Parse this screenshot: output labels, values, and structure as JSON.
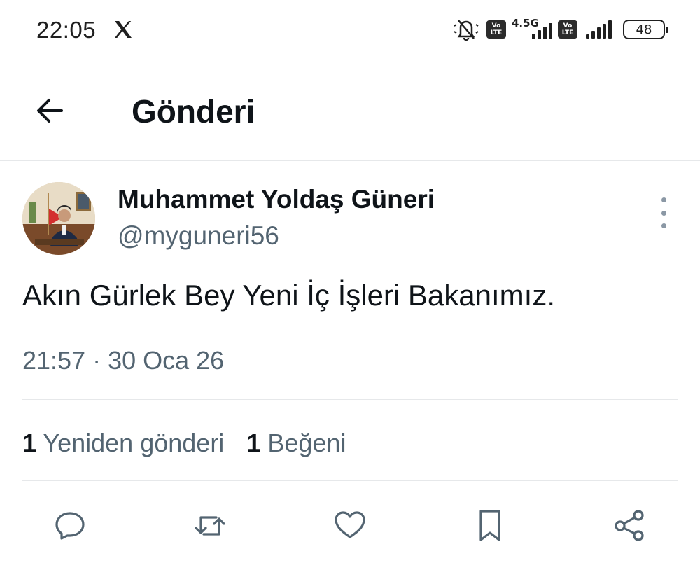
{
  "status_bar": {
    "time": "22:05",
    "app_icon": "x-logo-icon",
    "network_label": "4.5G",
    "volte_top": "Vo",
    "volte_bottom": "LTE",
    "battery": "48",
    "icons": [
      "silent-mode-icon",
      "volte-icon",
      "signal-icon",
      "volte-icon",
      "signal-icon",
      "battery-icon"
    ]
  },
  "header": {
    "back_icon": "arrow-left-icon",
    "title": "Gönderi"
  },
  "post": {
    "author_name": "Muhammet Yoldaş Güneri",
    "author_handle": "@myguneri56",
    "text": "Akın Gürlek Bey Yeni İç İşleri Bakanımız.",
    "time": "21:57",
    "separator": " · ",
    "date": "30 Oca 26",
    "reposts_count": "1",
    "reposts_label": "Yeniden gönderi",
    "likes_count": "1",
    "likes_label": "Beğeni"
  },
  "actions": [
    "reply-icon",
    "repost-icon",
    "like-icon",
    "bookmark-icon",
    "share-icon"
  ],
  "colors": {
    "text_primary": "#0f1419",
    "text_secondary": "#536471",
    "divider": "#e6e8ea",
    "icon_gray": "#536471"
  }
}
